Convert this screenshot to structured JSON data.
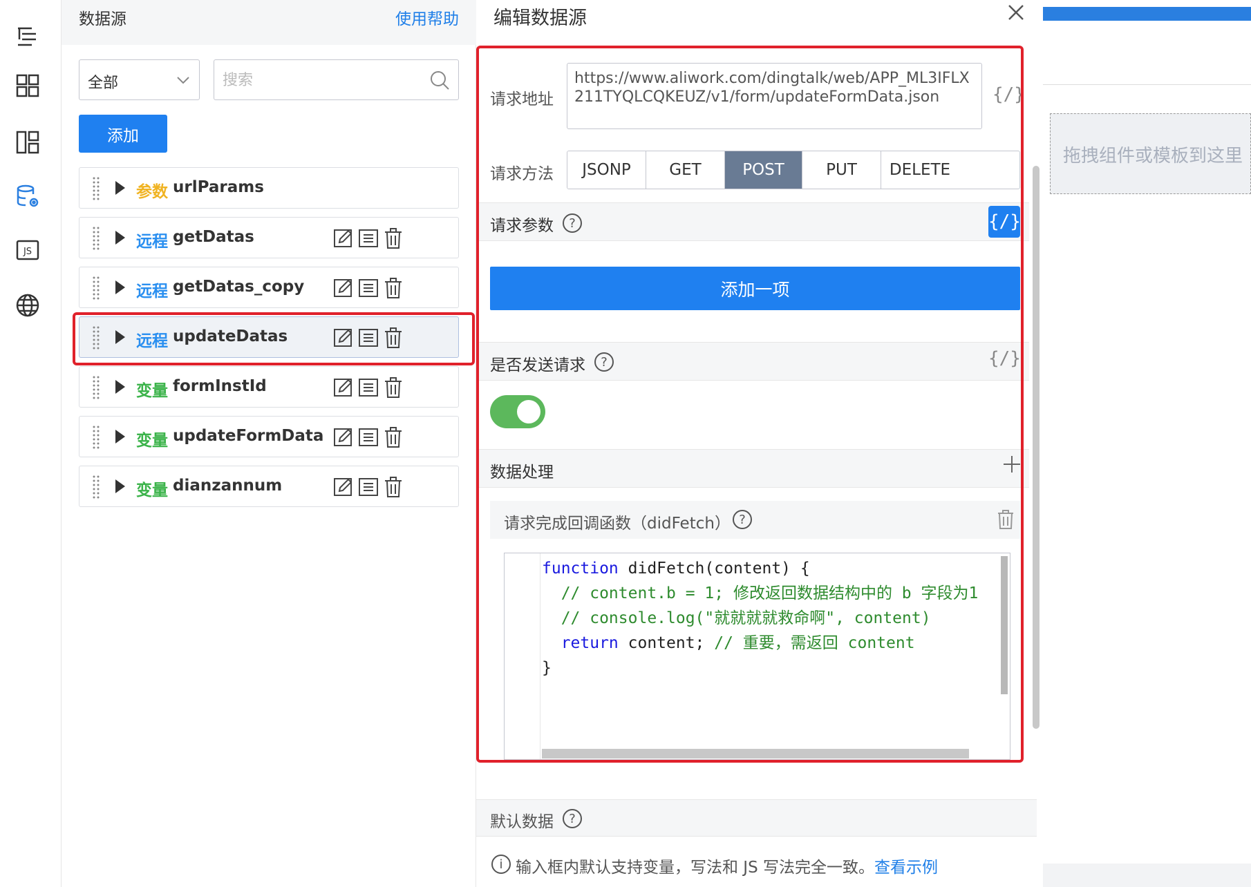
{
  "left_panel": {
    "title": "数据源",
    "help_link": "使用帮助",
    "filter_value": "全部",
    "search_placeholder": "搜索",
    "add_label": "添加",
    "items": [
      {
        "kind": "参数",
        "name": "urlParams",
        "type": "param",
        "actions": false
      },
      {
        "kind": "远程",
        "name": "getDatas",
        "type": "remote",
        "actions": true
      },
      {
        "kind": "远程",
        "name": "getDatas_copy",
        "type": "remote",
        "actions": true
      },
      {
        "kind": "远程",
        "name": "updateDatas",
        "type": "remote",
        "actions": true,
        "selected": true
      },
      {
        "kind": "变量",
        "name": "formInstId",
        "type": "var",
        "actions": true
      },
      {
        "kind": "变量",
        "name": "updateFormData",
        "type": "var",
        "actions": true
      },
      {
        "kind": "变量",
        "name": "dianzannum",
        "type": "var",
        "actions": true
      }
    ]
  },
  "edit_panel": {
    "title": "编辑数据源",
    "url_label": "请求地址",
    "url_value": "https://www.aliwork.com/dingtalk/web/APP_ML3IFLX211TYQLCQKEUZ/v1/form/updateFormData.json",
    "expr_toggle": "{/}",
    "method_label": "请求方法",
    "methods": [
      "JSONP",
      "GET",
      "POST",
      "PUT",
      "DELETE"
    ],
    "active_method": "POST",
    "params_label": "请求参数",
    "add_item_label": "添加一项",
    "send_label": "是否发送请求",
    "send_enabled": true,
    "data_process_label": "数据处理",
    "callback_label": "请求完成回调函数（didFetch）",
    "code": {
      "line1_kw": "function",
      "line1": " didFetch(content) {",
      "line2": "  // content.b = 1; 修改返回数据结构中的 b 字段为1",
      "line3": "  // console.log(\"就就就就救命啊\", content)",
      "line4_kw": "  return",
      "line4": " content; ",
      "line4_cm": "// 重要，需返回 content",
      "line5": "}"
    },
    "default_data_label": "默认数据",
    "note_text": "输入框内默认支持变量，写法和 JS 写法完全一致。",
    "note_link": "查看示例"
  },
  "canvas": {
    "drop_hint": "拖拽组件或模板到这里"
  },
  "colors": {
    "accent": "#1f80f0",
    "highlight": "#e0212b",
    "param": "#f0b322",
    "remote": "#2a8ff0",
    "var": "#3bb34a",
    "toggle_on": "#5cb85c"
  }
}
